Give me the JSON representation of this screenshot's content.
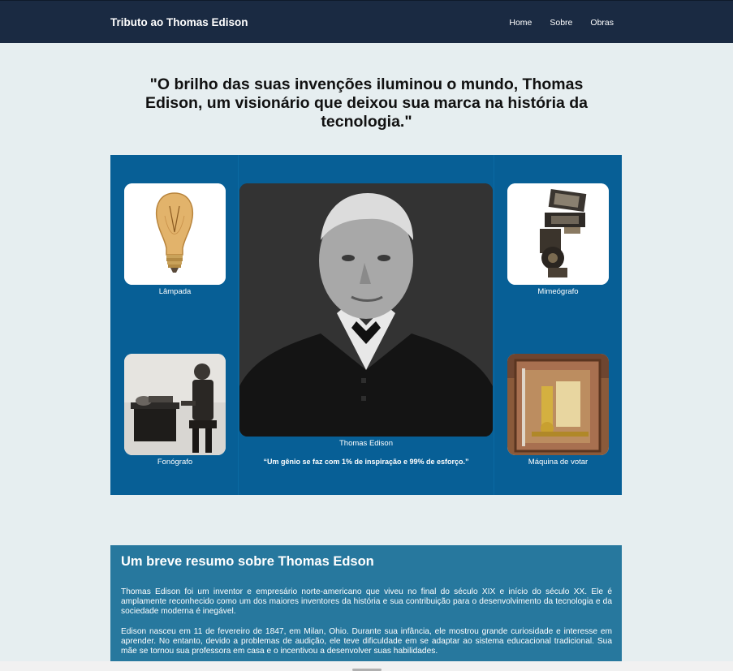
{
  "navbar": {
    "brand": "Tributo ao Thomas Edison",
    "links": [
      "Home",
      "Sobre",
      "Obras"
    ]
  },
  "headline": "\"O brilho das suas invenções iluminou o mundo, Thomas Edison, um visionário que deixou sua marca na história da tecnologia.\"",
  "gallery": {
    "items": [
      {
        "label": "Lâmpada",
        "icon": "light-bulb"
      },
      {
        "label": "Mimeógrafo",
        "icon": "mimeograph"
      },
      {
        "label": "Fonógrafo",
        "icon": "phonograph"
      },
      {
        "label": "Máquina de votar",
        "icon": "voting-machine"
      }
    ],
    "portrait_caption": "Thomas Edison",
    "quote": "“Um gênio se faz com 1% de inspiração e 99% de esforço.”"
  },
  "summary": {
    "title": "Um breve resumo sobre Thomas Edson",
    "paragraphs": [
      "Thomas Edison foi um inventor e empresário norte-americano que viveu no final do século XIX e início do século XX. Ele é amplamente reconhecido como um dos maiores inventores da história e sua contribuição para o desenvolvimento da tecnologia e da sociedade moderna é inegável.",
      "Edison nasceu em 11 de fevereiro de 1847, em Milan, Ohio. Durante sua infância, ele mostrou grande curiosidade e interesse em aprender. No entanto, devido a problemas de audição, ele teve dificuldade em se adaptar ao sistema educacional tradicional. Sua mãe se tornou sua professora em casa e o incentivou a desenvolver suas habilidades."
    ]
  },
  "colors": {
    "navbar": "#1a2a42",
    "background": "#e6eef0",
    "gallery": "#075f96",
    "summary": "#27789e"
  }
}
